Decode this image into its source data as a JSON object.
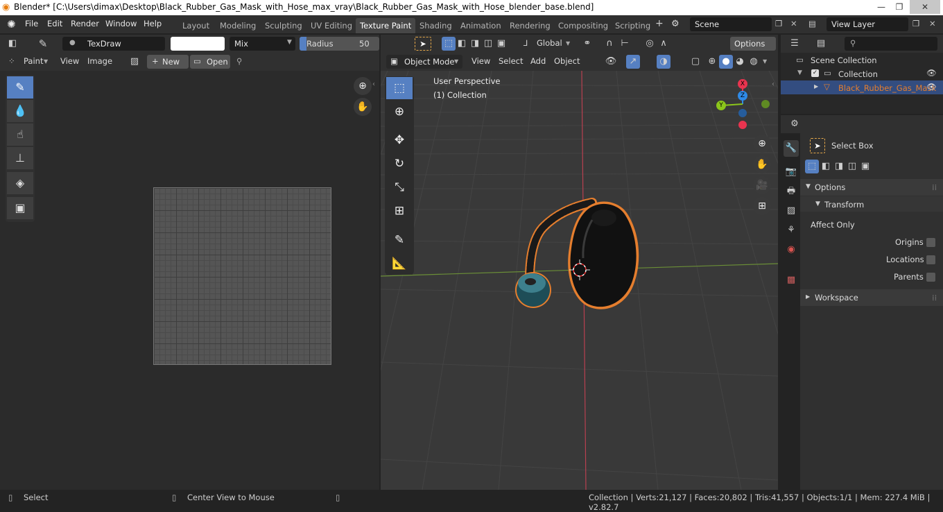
{
  "window": {
    "title": "Blender* [C:\\Users\\dimax\\Desktop\\Black_Rubber_Gas_Mask_with_Hose_max_vray\\Black_Rubber_Gas_Mask_with_Hose_blender_base.blend]",
    "minimize": "—",
    "maximize": "❐",
    "close": "✕"
  },
  "menu": [
    "File",
    "Edit",
    "Render",
    "Window",
    "Help"
  ],
  "workspaces": [
    {
      "label": "Layout"
    },
    {
      "label": "Modeling"
    },
    {
      "label": "Sculpting"
    },
    {
      "label": "UV Editing"
    },
    {
      "label": "Texture Paint",
      "active": true
    },
    {
      "label": "Shading"
    },
    {
      "label": "Animation"
    },
    {
      "label": "Rendering"
    },
    {
      "label": "Compositing"
    },
    {
      "label": "Scripting"
    }
  ],
  "scene": {
    "name": "Scene",
    "view_layer": "View Layer"
  },
  "image_editor": {
    "brush_name": "TexDraw",
    "blend_mode": "Mix",
    "radius_label": "Radius",
    "radius_value": "50 px",
    "mode": "Paint",
    "menus": [
      "View",
      "Image"
    ],
    "new_label": "New",
    "open_label": "Open"
  },
  "viewport": {
    "mode": "Object Mode",
    "menus": [
      "View",
      "Select",
      "Add",
      "Object"
    ],
    "orientation": "Global",
    "options_label": "Options",
    "overlay_line1": "User Perspective",
    "overlay_line2": "(1) Collection",
    "gizmo": {
      "x": "X",
      "y": "Y",
      "z": "Z"
    }
  },
  "outliner": {
    "root": "Scene Collection",
    "collection": "Collection",
    "object": "Black_Rubber_Gas_Mask"
  },
  "properties": {
    "tool_name": "Select Box",
    "options_label": "Options",
    "transform_label": "Transform",
    "affect_only": "Affect Only",
    "origins": "Origins",
    "locations": "Locations",
    "parents": "Parents",
    "workspace_label": "Workspace"
  },
  "statusbar": {
    "select": "Select",
    "center": "Center View to Mouse",
    "stats": "Collection | Verts:21,127 | Faces:20,802 | Tris:41,557 | Objects:1/1 | Mem: 227.4 MiB | v2.82.7"
  },
  "colors": {
    "accent": "#5680c2",
    "selected_orange": "#e57e2e",
    "x_axis": "#e8344f",
    "y_axis": "#8bc51b",
    "z_axis": "#2f8ae6"
  }
}
